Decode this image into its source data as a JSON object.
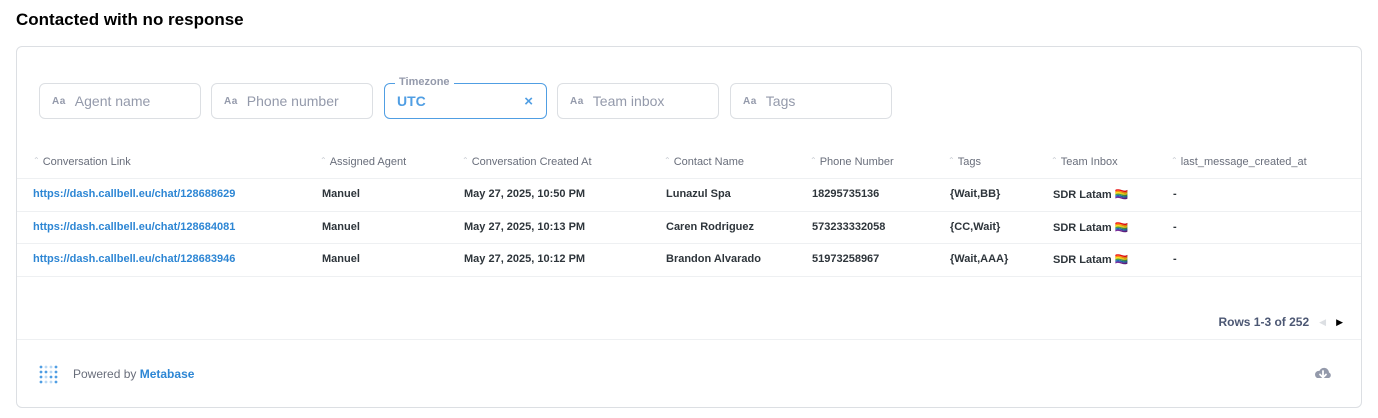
{
  "page": {
    "title": "Contacted with no response"
  },
  "filters": [
    {
      "icon": "Aa",
      "placeholder": "Agent name"
    },
    {
      "icon": "Aa",
      "placeholder": "Phone number"
    },
    {
      "label": "Timezone",
      "value": "UTC",
      "clear": "×"
    },
    {
      "icon": "Aa",
      "placeholder": "Team inbox"
    },
    {
      "icon": "Aa",
      "placeholder": "Tags"
    }
  ],
  "table": {
    "columns": [
      "Conversation Link",
      "Assigned Agent",
      "Conversation Created At",
      "Contact Name",
      "Phone Number",
      "Tags",
      "Team Inbox",
      "last_message_created_at"
    ],
    "rows": [
      [
        "https://dash.callbell.eu/chat/128688629",
        "Manuel",
        "May 27, 2025, 10:50 PM",
        "Lunazul Spa",
        "18295735136",
        "{Wait,BB}",
        "SDR Latam 🏳️‍🌈",
        "-"
      ],
      [
        "https://dash.callbell.eu/chat/128684081",
        "Manuel",
        "May 27, 2025, 10:13 PM",
        "Caren Rodriguez",
        "573233332058",
        "{CC,Wait}",
        "SDR Latam 🏳️‍🌈",
        "-"
      ],
      [
        "https://dash.callbell.eu/chat/128683946",
        "Manuel",
        "May 27, 2025, 10:12 PM",
        "Brandon Alvarado",
        "51973258967",
        "{Wait,AAA}",
        "SDR Latam 🏳️‍🌈",
        "-"
      ]
    ]
  },
  "pagination": {
    "label": "Rows 1-3 of 252",
    "prev_icon": "chevron-left-icon",
    "next_icon": "chevron-right-icon"
  },
  "footer": {
    "powered_prefix": "Powered by",
    "brand": "Metabase",
    "download_icon": "cloud-download-icon"
  },
  "colors": {
    "accent": "#509ee3",
    "link": "#2d86d4"
  }
}
